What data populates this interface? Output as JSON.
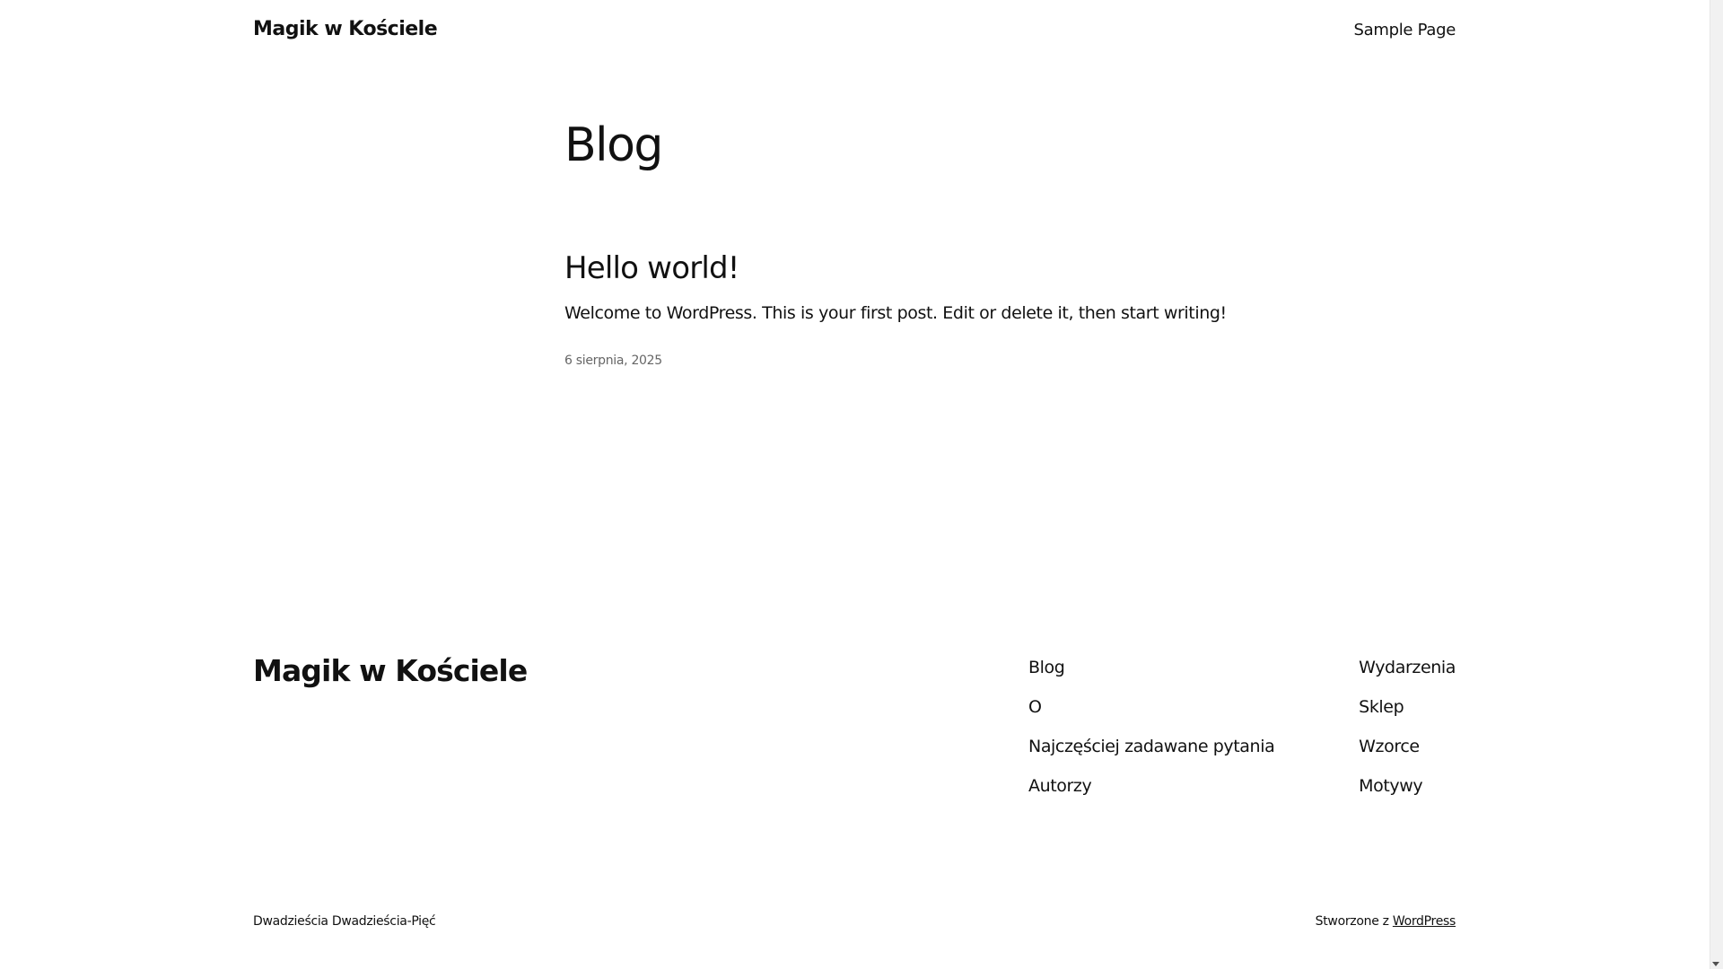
{
  "header": {
    "site_title": "Magik w Kościele",
    "nav_items": [
      "Sample Page"
    ]
  },
  "main": {
    "page_heading": "Blog",
    "post": {
      "title": "Hello world!",
      "excerpt": "Welcome to WordPress. This is your first post. Edit or delete it, then start writing!",
      "date": "6 sierpnia, 2025"
    }
  },
  "footer": {
    "site_title": "Magik w Kościele",
    "column_1": [
      "Blog",
      "O",
      "Najczęściej zadawane pytania",
      "Autorzy"
    ],
    "column_2": [
      "Wydarzenia",
      "Sklep",
      "Wzorce",
      "Motywy"
    ],
    "theme_credit": "Dwadzieścia Dwadzieścia-Pięć",
    "powered_by_prefix": "Stworzone z",
    "powered_by_link": "WordPress"
  }
}
